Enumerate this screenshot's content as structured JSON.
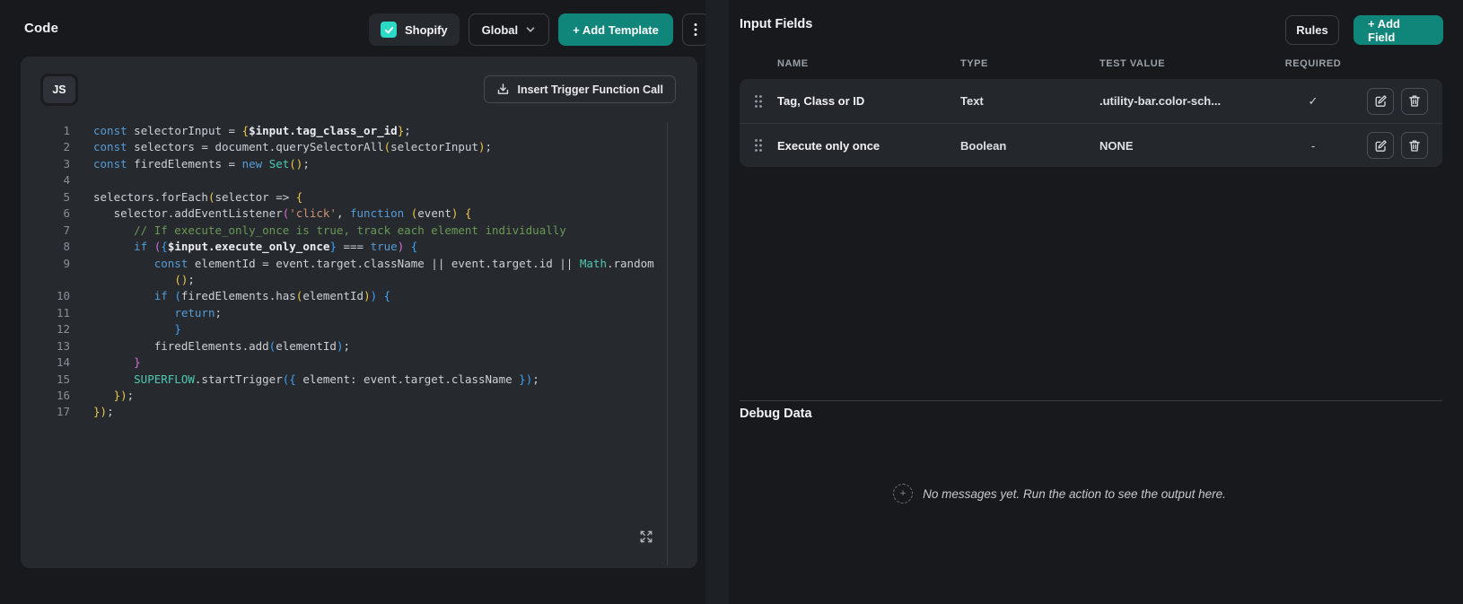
{
  "header": {
    "title": "Code",
    "shopify_checkbox": {
      "label": "Shopify",
      "checked": true
    },
    "scope_dropdown": {
      "value": "Global"
    },
    "add_template_button": "+ Add Template"
  },
  "editor": {
    "language_badge": "JS",
    "insert_button": "Insert Trigger Function Call",
    "lines": [
      {
        "num": "1",
        "tokens": [
          [
            "k",
            "const"
          ],
          [
            "d",
            " selectorInput = "
          ],
          [
            "y",
            "{"
          ],
          [
            "v",
            "$input.tag_class_or_id"
          ],
          [
            "y",
            "}"
          ],
          [
            "d",
            ";"
          ]
        ]
      },
      {
        "num": "2",
        "tokens": [
          [
            "k",
            "const"
          ],
          [
            "d",
            " selectors = document.querySelectorAll"
          ],
          [
            "y",
            "("
          ],
          [
            "d",
            "selectorInput"
          ],
          [
            "y",
            ")"
          ],
          [
            "d",
            ";"
          ]
        ]
      },
      {
        "num": "3",
        "tokens": [
          [
            "k",
            "const"
          ],
          [
            "d",
            " firedElements = "
          ],
          [
            "k",
            "new"
          ],
          [
            "d",
            " "
          ],
          [
            "t",
            "Set"
          ],
          [
            "y",
            "()"
          ],
          [
            "d",
            ";"
          ]
        ]
      },
      {
        "num": "4",
        "tokens": []
      },
      {
        "num": "5",
        "tokens": [
          [
            "d",
            "selectors.forEach"
          ],
          [
            "y",
            "("
          ],
          [
            "d",
            "selector => "
          ],
          [
            "y",
            "{"
          ]
        ]
      },
      {
        "num": "6",
        "tokens": [
          [
            "d",
            "   selector.addEventListener"
          ],
          [
            "p",
            "("
          ],
          [
            "s",
            "'click'"
          ],
          [
            "d",
            ", "
          ],
          [
            "k",
            "function"
          ],
          [
            "d",
            " "
          ],
          [
            "y",
            "("
          ],
          [
            "d",
            "event"
          ],
          [
            "y",
            ")"
          ],
          [
            "d",
            " "
          ],
          [
            "y",
            "{"
          ]
        ]
      },
      {
        "num": "7",
        "tokens": [
          [
            "c",
            "      // If execute_only_once is true, track each element individually"
          ]
        ]
      },
      {
        "num": "8",
        "tokens": [
          [
            "d",
            "      "
          ],
          [
            "k",
            "if"
          ],
          [
            "d",
            " "
          ],
          [
            "p",
            "("
          ],
          [
            "b",
            "{"
          ],
          [
            "v",
            "$input.execute_only_once"
          ],
          [
            "b",
            "}"
          ],
          [
            "d",
            " === "
          ],
          [
            "k",
            "true"
          ],
          [
            "p",
            ")"
          ],
          [
            "d",
            " "
          ],
          [
            "b",
            "{"
          ]
        ]
      },
      {
        "num": "9",
        "tokens": [
          [
            "d",
            "         "
          ],
          [
            "k",
            "const"
          ],
          [
            "d",
            " elementId = event.target.className || event.target.id || "
          ],
          [
            "t",
            "Math"
          ],
          [
            "d",
            ".random"
          ]
        ]
      },
      {
        "num": "",
        "tokens": [
          [
            "d",
            "            "
          ],
          [
            "y",
            "()"
          ],
          [
            "d",
            ";"
          ]
        ]
      },
      {
        "num": "10",
        "tokens": [
          [
            "d",
            "         "
          ],
          [
            "k",
            "if"
          ],
          [
            "d",
            " "
          ],
          [
            "b",
            "("
          ],
          [
            "d",
            "firedElements.has"
          ],
          [
            "y",
            "("
          ],
          [
            "d",
            "elementId"
          ],
          [
            "y",
            ")"
          ],
          [
            "b",
            ")"
          ],
          [
            "d",
            " "
          ],
          [
            "b",
            "{"
          ]
        ]
      },
      {
        "num": "11",
        "tokens": [
          [
            "d",
            "            "
          ],
          [
            "k",
            "return"
          ],
          [
            "d",
            ";"
          ]
        ]
      },
      {
        "num": "12",
        "tokens": [
          [
            "d",
            "            "
          ],
          [
            "b",
            "}"
          ]
        ]
      },
      {
        "num": "13",
        "tokens": [
          [
            "d",
            "         firedElements.add"
          ],
          [
            "b",
            "("
          ],
          [
            "d",
            "elementId"
          ],
          [
            "b",
            ")"
          ],
          [
            "d",
            ";"
          ]
        ]
      },
      {
        "num": "14",
        "tokens": [
          [
            "d",
            "      "
          ],
          [
            "p",
            "}"
          ]
        ]
      },
      {
        "num": "15",
        "tokens": [
          [
            "d",
            "      "
          ],
          [
            "t",
            "SUPERFLOW"
          ],
          [
            "d",
            ".startTrigger"
          ],
          [
            "b",
            "("
          ],
          [
            "b",
            "{"
          ],
          [
            "d",
            " element: event.target.className "
          ],
          [
            "b",
            "}"
          ],
          [
            "b",
            ")"
          ],
          [
            "d",
            ";"
          ]
        ]
      },
      {
        "num": "16",
        "tokens": [
          [
            "d",
            "   "
          ],
          [
            "y",
            "})"
          ],
          [
            "d",
            ";"
          ]
        ]
      },
      {
        "num": "17",
        "tokens": [
          [
            "y",
            "})"
          ],
          [
            "d",
            ";"
          ]
        ]
      }
    ]
  },
  "fields": {
    "title": "Input Fields",
    "rules_button": "Rules",
    "add_field_button": "+ Add Field",
    "headers": [
      "NAME",
      "TYPE",
      "TEST VALUE",
      "REQUIRED"
    ],
    "rows": [
      {
        "name": "Tag, Class or ID",
        "type": "Text",
        "test_value": ".utility-bar.color-sch...",
        "required": "✓"
      },
      {
        "name": "Execute only once",
        "type": "Boolean",
        "test_value": "NONE",
        "required": "-"
      }
    ]
  },
  "debug": {
    "title": "Debug Data",
    "empty_icon": "+",
    "empty_message": "No messages yet. Run the action to see the output here."
  },
  "icons": {
    "checkbox": "check-icon",
    "dropdown": "chevron-down-icon",
    "menu": "kebab-menu-icon",
    "insert": "insert-download-icon",
    "expand": "fullscreen-expand-icon",
    "drag": "drag-handle-icon",
    "edit": "edit-pencil-icon",
    "delete": "trash-icon",
    "empty": "sparkle-dotted-icon"
  },
  "colors": {
    "accent_teal": "#10857a",
    "checkbox_teal": "#2cd9c5",
    "page_bg": "#17191c",
    "card_bg": "#26292e"
  }
}
